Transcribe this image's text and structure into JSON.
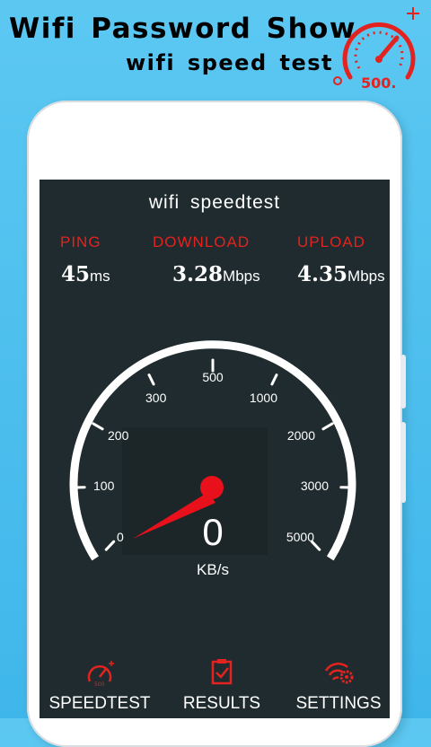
{
  "promo": {
    "title": "Wifi Password Show",
    "subtitle": "wifi speed test",
    "logo_text": "500."
  },
  "screen": {
    "title": "wifi speedtest"
  },
  "stats": {
    "ping": {
      "label": "PING",
      "value": "45",
      "unit": "ms"
    },
    "download": {
      "label": "DOWNLOAD",
      "value": "3.28",
      "unit": "Mbps"
    },
    "upload": {
      "label": "UPLOAD",
      "value": "4.35",
      "unit": "Mbps"
    }
  },
  "gauge": {
    "ticks": [
      "0",
      "100",
      "200",
      "300",
      "500",
      "1000",
      "2000",
      "3000",
      "5000"
    ],
    "value": "0",
    "unit": "KB/s",
    "needle_color": "#e8101a"
  },
  "nav": {
    "items": [
      {
        "label": "SPEEDTEST",
        "icon": "speedometer-icon"
      },
      {
        "label": "RESULTS",
        "icon": "clipboard-check-icon"
      },
      {
        "label": "SETTINGS",
        "icon": "wifi-gear-icon"
      }
    ]
  },
  "colors": {
    "accent_red": "#e3231f",
    "screen_bg": "#1f2b2e",
    "background": "#45bbeb"
  }
}
